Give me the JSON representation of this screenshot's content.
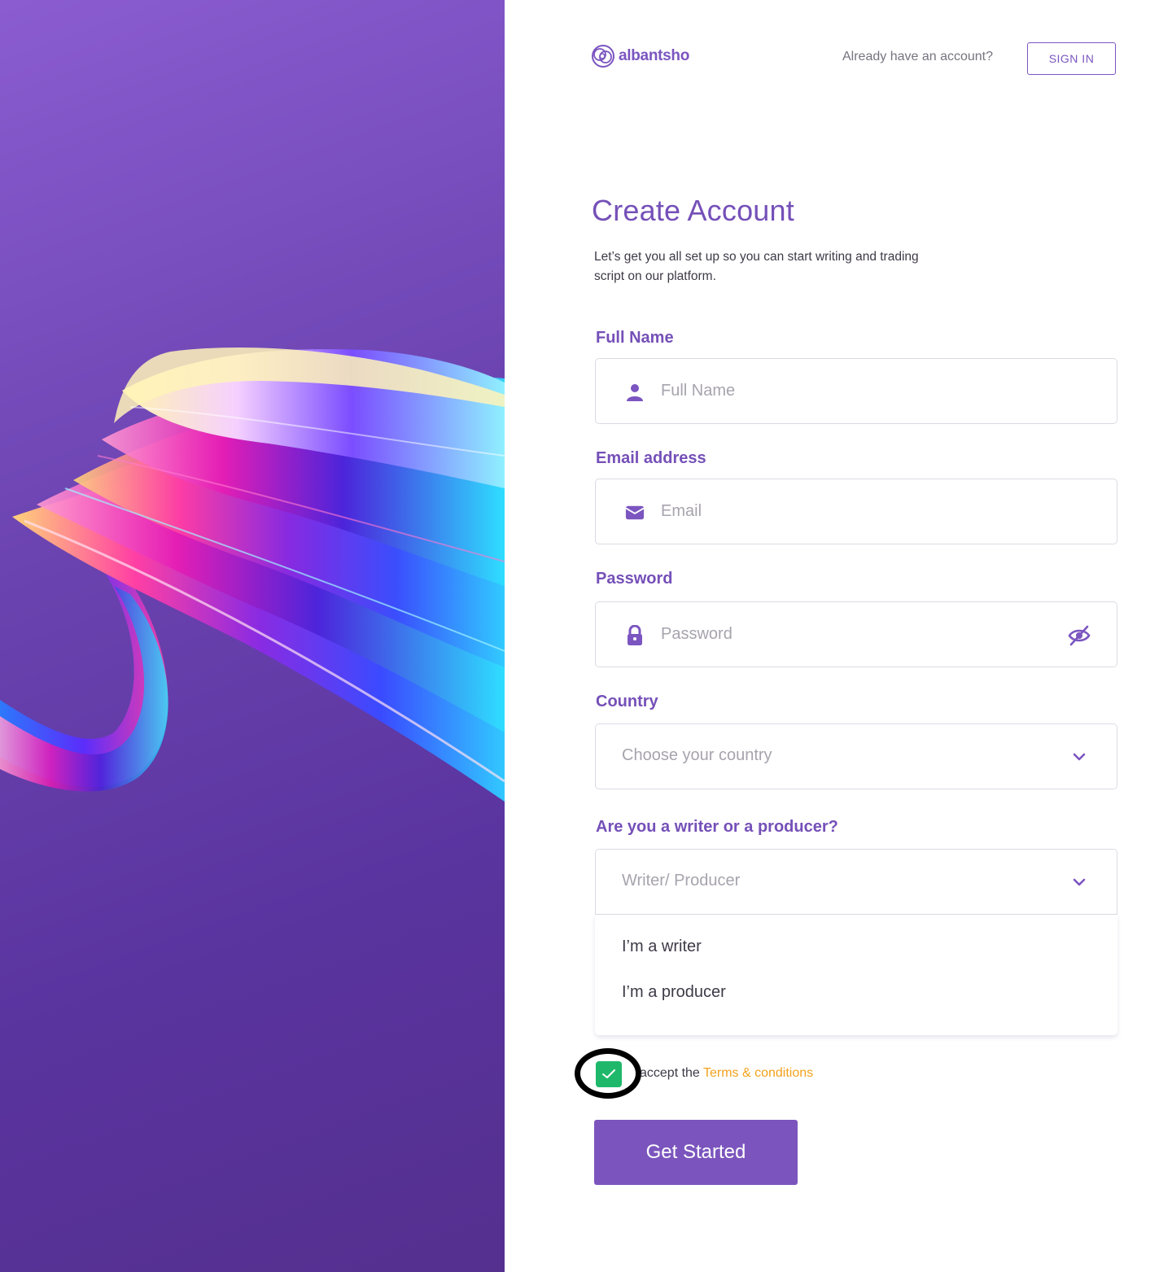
{
  "brand": {
    "name": "albantsho"
  },
  "header": {
    "signin_prompt": "Already have an account?",
    "signin_label": "SIGN IN"
  },
  "page": {
    "title": "Create Account",
    "intro": "Let’s get you all set up so you can start writing and trading script on our platform."
  },
  "form": {
    "full_name": {
      "label": "Full Name",
      "placeholder": "Full Name",
      "value": ""
    },
    "email": {
      "label": "Email address",
      "placeholder": "Email",
      "value": ""
    },
    "password": {
      "label": "Password",
      "placeholder": "Password",
      "value": ""
    },
    "country": {
      "label": "Country",
      "selected": "Choose your country"
    },
    "role": {
      "label": "Are you a writer or a producer?",
      "selected": "Writer/ Producer",
      "options": [
        "I’m a writer",
        "I’m a producer"
      ]
    },
    "terms": {
      "checked": true,
      "prefix": "accept the",
      "link_label": "Terms & conditions"
    },
    "submit_label": "Get Started"
  },
  "icons": {
    "logo": "spiral-logo-icon",
    "full_name": "user-icon",
    "email": "envelope-icon",
    "password": "lock-icon",
    "password_toggle": "eye-off-icon",
    "select": "chevron-down-icon",
    "checkbox": "checkmark-icon"
  },
  "colors": {
    "accent": "#7550b8",
    "button": "#7b55bd",
    "link": "#f2a21c",
    "checkbox": "#1fb86a",
    "left_panel": "#6b43b0"
  }
}
